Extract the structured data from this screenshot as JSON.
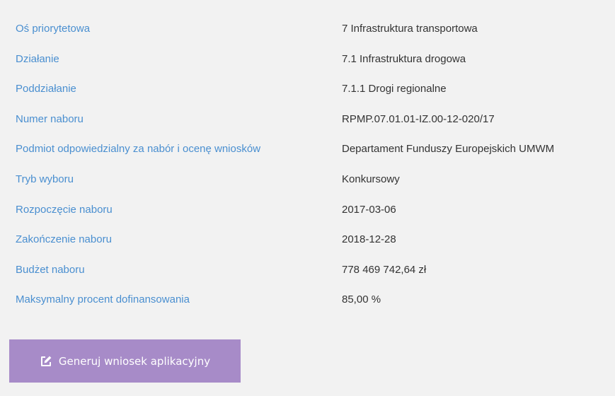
{
  "details": [
    {
      "label": "Oś priorytetowa",
      "value": "7 Infrastruktura transportowa"
    },
    {
      "label": "Działanie",
      "value": "7.1 Infrastruktura drogowa"
    },
    {
      "label": "Poddziałanie",
      "value": "7.1.1 Drogi regionalne"
    },
    {
      "label": "Numer naboru",
      "value": "RPMP.07.01.01-IZ.00-12-020/17"
    },
    {
      "label": "Podmiot odpowiedzialny za nabór i ocenę wniosków",
      "value": "Departament Funduszy Europejskich UMWM"
    },
    {
      "label": "Tryb wyboru",
      "value": "Konkursowy"
    },
    {
      "label": "Rozpoczęcie naboru",
      "value": "2017-03-06"
    },
    {
      "label": "Zakończenie naboru",
      "value": "2018-12-28"
    },
    {
      "label": "Budżet naboru",
      "value": "778 469 742,64 zł"
    },
    {
      "label": "Maksymalny procent dofinansowania",
      "value": "85,00 %"
    }
  ],
  "actions": {
    "generate_label": "Generuj wniosek aplikacyjny",
    "generate_icon": "edit-icon"
  },
  "colors": {
    "label": "#4a8fd0",
    "value": "#333333",
    "button_bg": "#a78bc8",
    "background": "#f2f2f2"
  }
}
